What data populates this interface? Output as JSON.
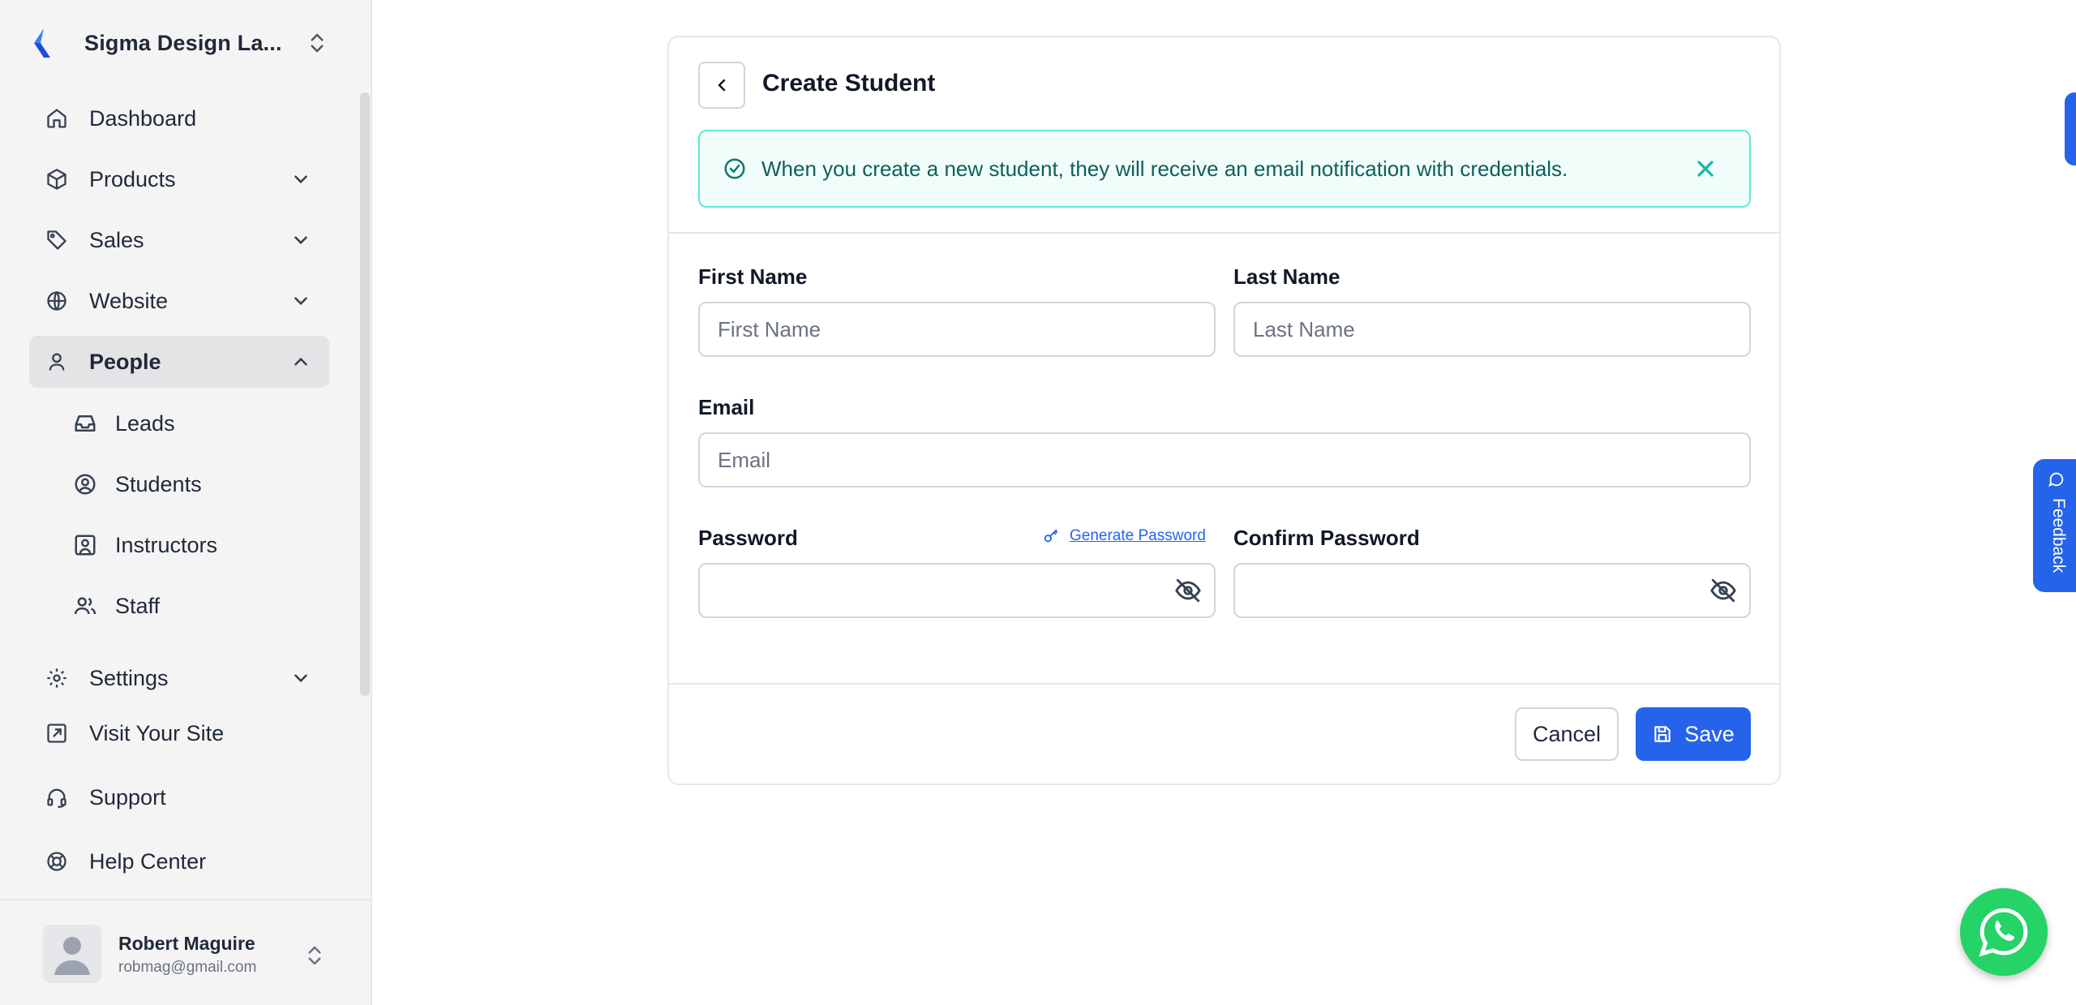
{
  "sidebar": {
    "org_name": "Sigma Design La...",
    "items": [
      {
        "label": "Dashboard"
      },
      {
        "label": "Products"
      },
      {
        "label": "Sales"
      },
      {
        "label": "Website"
      },
      {
        "label": "People"
      },
      {
        "label": "Settings"
      },
      {
        "label": "Visit Your Site"
      },
      {
        "label": "Support"
      },
      {
        "label": "Help Center"
      }
    ],
    "people_sub": [
      {
        "label": "Leads"
      },
      {
        "label": "Students"
      },
      {
        "label": "Instructors"
      },
      {
        "label": "Staff"
      }
    ],
    "user": {
      "name": "Robert Maguire",
      "email": "robmag@gmail.com"
    }
  },
  "form": {
    "title": "Create Student",
    "alert": "When you create a new student, they will receive an email notification with credentials.",
    "first_name": {
      "label": "First Name",
      "placeholder": "First Name",
      "value": ""
    },
    "last_name": {
      "label": "Last Name",
      "placeholder": "Last Name",
      "value": ""
    },
    "email": {
      "label": "Email",
      "placeholder": "Email",
      "value": ""
    },
    "password": {
      "label": "Password",
      "value": ""
    },
    "confirm_password": {
      "label": "Confirm Password",
      "value": ""
    },
    "generate_password": "Generate Password",
    "cancel_label": "Cancel",
    "save_label": "Save"
  },
  "widgets": {
    "feedback_label": "Feedback"
  },
  "colors": {
    "primary": "#2563eb",
    "alert_bg": "#f0fdfa",
    "alert_border": "#5eead4",
    "whatsapp": "#25d366"
  }
}
